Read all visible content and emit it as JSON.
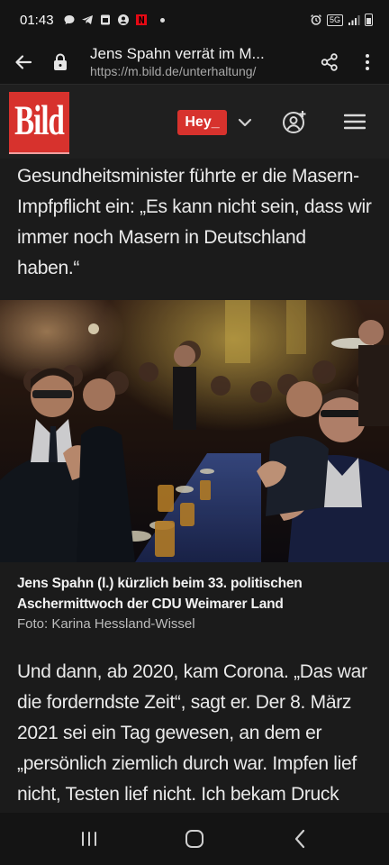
{
  "status_bar": {
    "time": "01:43",
    "icons_left": [
      "chat-icon",
      "telegram-icon",
      "sim-icon",
      "account-icon",
      "netflix-icon",
      "dot-icon"
    ],
    "icons_right": [
      "alarm-icon",
      "5g-icon",
      "signal-icon",
      "battery-icon"
    ],
    "network_label": "5G"
  },
  "url_bar": {
    "title": "Jens Spahn verrät im M...",
    "address": "https://m.bild.de/unterhaltung/"
  },
  "bild_header": {
    "logo_text": "Bild",
    "hey_label": "Hey_"
  },
  "article": {
    "para_top": "Gesundheitsminister führte er die Masern-Impfpflicht ein: „Es kann nicht sein, dass wir immer noch Masern in Deutschland haben.“",
    "caption_title": "Jens Spahn (l.) kürzlich beim 33. politischen Aschermittwoch der CDU Weimarer Land",
    "caption_credit": "Foto: Karina Hessland-Wissel",
    "para_bottom": "Und dann, ab 2020, kam Corona. „Das war die forderndste Zeit“, sagt er. Der 8. März 2021 sei ein Tag gewesen, an dem er „persönlich ziemlich durch war. Impfen lief nicht, Testen lief nicht. Ich bekam Druck von allen Seiten“. Weint man da auch mal als Politiker? „Geweint habe ich nicht. Es"
  },
  "colors": {
    "brand_red": "#d7322d",
    "background": "#1b1b1b",
    "bar": "#141414"
  }
}
